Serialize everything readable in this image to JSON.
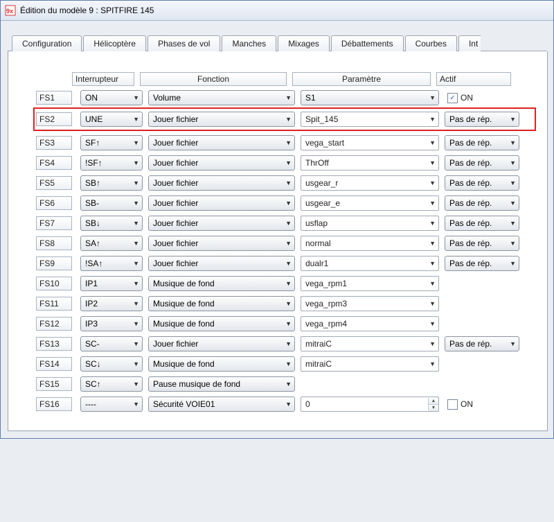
{
  "window_title": "Édition du modèle 9 : SPITFIRE 145",
  "tabs": [
    "Configuration",
    "Hélicoptère",
    "Phases de vol",
    "Manches",
    "Mixages",
    "Débattements",
    "Courbes",
    "Int"
  ],
  "headers": {
    "interrupteur": "Interrupteur",
    "fonction": "Fonction",
    "parametre": "Paramètre",
    "actif": "Actif"
  },
  "rows": [
    {
      "fs": "FS1",
      "sw": "ON",
      "fn": "Volume",
      "partype": "combo",
      "par": "S1",
      "act": {
        "type": "check",
        "checked": true,
        "label": "ON"
      },
      "hl": false
    },
    {
      "fs": "FS2",
      "sw": "UNE",
      "fn": "Jouer fichier",
      "partype": "text",
      "par": "Spit_145",
      "act": {
        "type": "combo",
        "label": "Pas de rép."
      },
      "hl": true
    },
    {
      "fs": "FS3",
      "sw": "SF↑",
      "fn": "Jouer fichier",
      "partype": "text",
      "par": "vega_start",
      "act": {
        "type": "combo",
        "label": "Pas de rép."
      },
      "hl": false
    },
    {
      "fs": "FS4",
      "sw": "!SF↑",
      "fn": "Jouer fichier",
      "partype": "text",
      "par": "ThrOff",
      "act": {
        "type": "combo",
        "label": "Pas de rép."
      },
      "hl": false
    },
    {
      "fs": "FS5",
      "sw": "SB↑",
      "fn": "Jouer fichier",
      "partype": "text",
      "par": "usgear_r",
      "act": {
        "type": "combo",
        "label": "Pas de rép."
      },
      "hl": false
    },
    {
      "fs": "FS6",
      "sw": "SB-",
      "fn": "Jouer fichier",
      "partype": "text",
      "par": "usgear_e",
      "act": {
        "type": "combo",
        "label": "Pas de rép."
      },
      "hl": false
    },
    {
      "fs": "FS7",
      "sw": "SB↓",
      "fn": "Jouer fichier",
      "partype": "text",
      "par": "usflap",
      "act": {
        "type": "combo",
        "label": "Pas de rép."
      },
      "hl": false
    },
    {
      "fs": "FS8",
      "sw": "SA↑",
      "fn": "Jouer fichier",
      "partype": "text",
      "par": "normal",
      "act": {
        "type": "combo",
        "label": "Pas de rép."
      },
      "hl": false
    },
    {
      "fs": "FS9",
      "sw": "!SA↑",
      "fn": "Jouer fichier",
      "partype": "text",
      "par": "dualr1",
      "act": {
        "type": "combo",
        "label": "Pas de rép."
      },
      "hl": false
    },
    {
      "fs": "FS10",
      "sw": "IP1",
      "fn": "Musique de fond",
      "partype": "text",
      "par": "vega_rpm1",
      "act": null,
      "hl": false
    },
    {
      "fs": "FS11",
      "sw": "IP2",
      "fn": "Musique de fond",
      "partype": "text",
      "par": "vega_rpm3",
      "act": null,
      "hl": false
    },
    {
      "fs": "FS12",
      "sw": "IP3",
      "fn": "Musique de fond",
      "partype": "text",
      "par": "vega_rpm4",
      "act": null,
      "hl": false
    },
    {
      "fs": "FS13",
      "sw": "SC-",
      "fn": "Jouer fichier",
      "partype": "text",
      "par": "mitraiC",
      "act": {
        "type": "combo",
        "label": "Pas de rép."
      },
      "hl": false
    },
    {
      "fs": "FS14",
      "sw": "SC↓",
      "fn": "Musique de fond",
      "partype": "text",
      "par": "mitraiC",
      "act": null,
      "hl": false
    },
    {
      "fs": "FS15",
      "sw": "SC↑",
      "fn": "Pause musique de fond",
      "partype": "none",
      "par": "",
      "act": null,
      "hl": false
    },
    {
      "fs": "FS16",
      "sw": "----",
      "fn": "Sécurité VOIE01",
      "partype": "spin",
      "par": "0",
      "act": {
        "type": "check",
        "checked": false,
        "label": "ON"
      },
      "hl": false
    }
  ]
}
